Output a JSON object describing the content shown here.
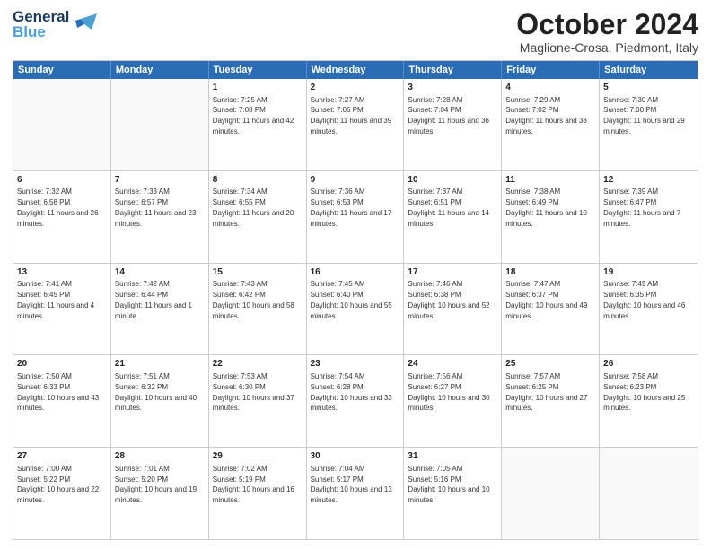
{
  "header": {
    "logo_line1": "General",
    "logo_line2": "Blue",
    "month_title": "October 2024",
    "location": "Maglione-Crosa, Piedmont, Italy"
  },
  "days_of_week": [
    "Sunday",
    "Monday",
    "Tuesday",
    "Wednesday",
    "Thursday",
    "Friday",
    "Saturday"
  ],
  "weeks": [
    [
      {
        "day": "",
        "sunrise": "",
        "sunset": "",
        "daylight": ""
      },
      {
        "day": "",
        "sunrise": "",
        "sunset": "",
        "daylight": ""
      },
      {
        "day": "1",
        "sunrise": "Sunrise: 7:25 AM",
        "sunset": "Sunset: 7:08 PM",
        "daylight": "Daylight: 11 hours and 42 minutes."
      },
      {
        "day": "2",
        "sunrise": "Sunrise: 7:27 AM",
        "sunset": "Sunset: 7:06 PM",
        "daylight": "Daylight: 11 hours and 39 minutes."
      },
      {
        "day": "3",
        "sunrise": "Sunrise: 7:28 AM",
        "sunset": "Sunset: 7:04 PM",
        "daylight": "Daylight: 11 hours and 36 minutes."
      },
      {
        "day": "4",
        "sunrise": "Sunrise: 7:29 AM",
        "sunset": "Sunset: 7:02 PM",
        "daylight": "Daylight: 11 hours and 33 minutes."
      },
      {
        "day": "5",
        "sunrise": "Sunrise: 7:30 AM",
        "sunset": "Sunset: 7:00 PM",
        "daylight": "Daylight: 11 hours and 29 minutes."
      }
    ],
    [
      {
        "day": "6",
        "sunrise": "Sunrise: 7:32 AM",
        "sunset": "Sunset: 6:58 PM",
        "daylight": "Daylight: 11 hours and 26 minutes."
      },
      {
        "day": "7",
        "sunrise": "Sunrise: 7:33 AM",
        "sunset": "Sunset: 6:57 PM",
        "daylight": "Daylight: 11 hours and 23 minutes."
      },
      {
        "day": "8",
        "sunrise": "Sunrise: 7:34 AM",
        "sunset": "Sunset: 6:55 PM",
        "daylight": "Daylight: 11 hours and 20 minutes."
      },
      {
        "day": "9",
        "sunrise": "Sunrise: 7:36 AM",
        "sunset": "Sunset: 6:53 PM",
        "daylight": "Daylight: 11 hours and 17 minutes."
      },
      {
        "day": "10",
        "sunrise": "Sunrise: 7:37 AM",
        "sunset": "Sunset: 6:51 PM",
        "daylight": "Daylight: 11 hours and 14 minutes."
      },
      {
        "day": "11",
        "sunrise": "Sunrise: 7:38 AM",
        "sunset": "Sunset: 6:49 PM",
        "daylight": "Daylight: 11 hours and 10 minutes."
      },
      {
        "day": "12",
        "sunrise": "Sunrise: 7:39 AM",
        "sunset": "Sunset: 6:47 PM",
        "daylight": "Daylight: 11 hours and 7 minutes."
      }
    ],
    [
      {
        "day": "13",
        "sunrise": "Sunrise: 7:41 AM",
        "sunset": "Sunset: 6:45 PM",
        "daylight": "Daylight: 11 hours and 4 minutes."
      },
      {
        "day": "14",
        "sunrise": "Sunrise: 7:42 AM",
        "sunset": "Sunset: 6:44 PM",
        "daylight": "Daylight: 11 hours and 1 minute."
      },
      {
        "day": "15",
        "sunrise": "Sunrise: 7:43 AM",
        "sunset": "Sunset: 6:42 PM",
        "daylight": "Daylight: 10 hours and 58 minutes."
      },
      {
        "day": "16",
        "sunrise": "Sunrise: 7:45 AM",
        "sunset": "Sunset: 6:40 PM",
        "daylight": "Daylight: 10 hours and 55 minutes."
      },
      {
        "day": "17",
        "sunrise": "Sunrise: 7:46 AM",
        "sunset": "Sunset: 6:38 PM",
        "daylight": "Daylight: 10 hours and 52 minutes."
      },
      {
        "day": "18",
        "sunrise": "Sunrise: 7:47 AM",
        "sunset": "Sunset: 6:37 PM",
        "daylight": "Daylight: 10 hours and 49 minutes."
      },
      {
        "day": "19",
        "sunrise": "Sunrise: 7:49 AM",
        "sunset": "Sunset: 6:35 PM",
        "daylight": "Daylight: 10 hours and 46 minutes."
      }
    ],
    [
      {
        "day": "20",
        "sunrise": "Sunrise: 7:50 AM",
        "sunset": "Sunset: 6:33 PM",
        "daylight": "Daylight: 10 hours and 43 minutes."
      },
      {
        "day": "21",
        "sunrise": "Sunrise: 7:51 AM",
        "sunset": "Sunset: 6:32 PM",
        "daylight": "Daylight: 10 hours and 40 minutes."
      },
      {
        "day": "22",
        "sunrise": "Sunrise: 7:53 AM",
        "sunset": "Sunset: 6:30 PM",
        "daylight": "Daylight: 10 hours and 37 minutes."
      },
      {
        "day": "23",
        "sunrise": "Sunrise: 7:54 AM",
        "sunset": "Sunset: 6:28 PM",
        "daylight": "Daylight: 10 hours and 33 minutes."
      },
      {
        "day": "24",
        "sunrise": "Sunrise: 7:56 AM",
        "sunset": "Sunset: 6:27 PM",
        "daylight": "Daylight: 10 hours and 30 minutes."
      },
      {
        "day": "25",
        "sunrise": "Sunrise: 7:57 AM",
        "sunset": "Sunset: 6:25 PM",
        "daylight": "Daylight: 10 hours and 27 minutes."
      },
      {
        "day": "26",
        "sunrise": "Sunrise: 7:58 AM",
        "sunset": "Sunset: 6:23 PM",
        "daylight": "Daylight: 10 hours and 25 minutes."
      }
    ],
    [
      {
        "day": "27",
        "sunrise": "Sunrise: 7:00 AM",
        "sunset": "Sunset: 5:22 PM",
        "daylight": "Daylight: 10 hours and 22 minutes."
      },
      {
        "day": "28",
        "sunrise": "Sunrise: 7:01 AM",
        "sunset": "Sunset: 5:20 PM",
        "daylight": "Daylight: 10 hours and 19 minutes."
      },
      {
        "day": "29",
        "sunrise": "Sunrise: 7:02 AM",
        "sunset": "Sunset: 5:19 PM",
        "daylight": "Daylight: 10 hours and 16 minutes."
      },
      {
        "day": "30",
        "sunrise": "Sunrise: 7:04 AM",
        "sunset": "Sunset: 5:17 PM",
        "daylight": "Daylight: 10 hours and 13 minutes."
      },
      {
        "day": "31",
        "sunrise": "Sunrise: 7:05 AM",
        "sunset": "Sunset: 5:16 PM",
        "daylight": "Daylight: 10 hours and 10 minutes."
      },
      {
        "day": "",
        "sunrise": "",
        "sunset": "",
        "daylight": ""
      },
      {
        "day": "",
        "sunrise": "",
        "sunset": "",
        "daylight": ""
      }
    ]
  ]
}
